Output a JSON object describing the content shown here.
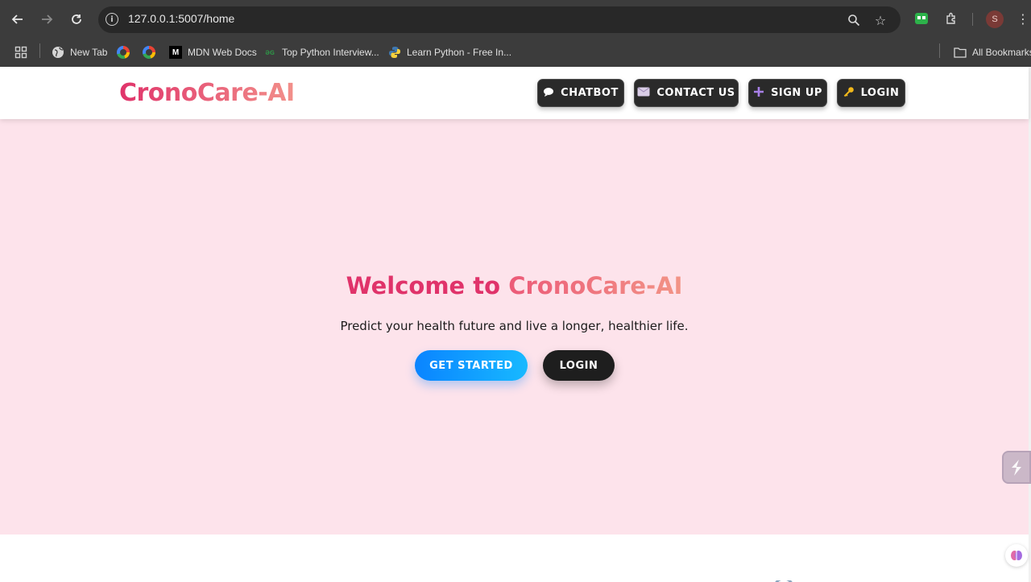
{
  "browser": {
    "url": "127.0.0.1:5007/home",
    "bookmarks": [
      {
        "label": "New Tab"
      },
      {
        "label": "MDN Web Docs"
      },
      {
        "label": "Top Python Interview..."
      },
      {
        "label": "Learn Python - Free In..."
      }
    ],
    "all_bookmarks_label": "All Bookmarks",
    "profile_initial": "S"
  },
  "site": {
    "logo": "CronoCare-AI",
    "nav": {
      "chatbot": "CHATBOT",
      "contact": "CONTACT US",
      "signup": "SIGN UP",
      "login": "LOGIN"
    }
  },
  "hero": {
    "title_part1": "Welcome to ",
    "title_part2": "CronoCare-AI",
    "subtitle": "Predict your health future and live a longer, healthier life.",
    "get_started": "GET STARTED",
    "login": "LOGIN"
  },
  "colors": {
    "brand_pink": "#e0336a",
    "hero_bg": "#fde3eb",
    "primary_blue": "#0a84ff",
    "dark_button": "#1e1e1e"
  }
}
